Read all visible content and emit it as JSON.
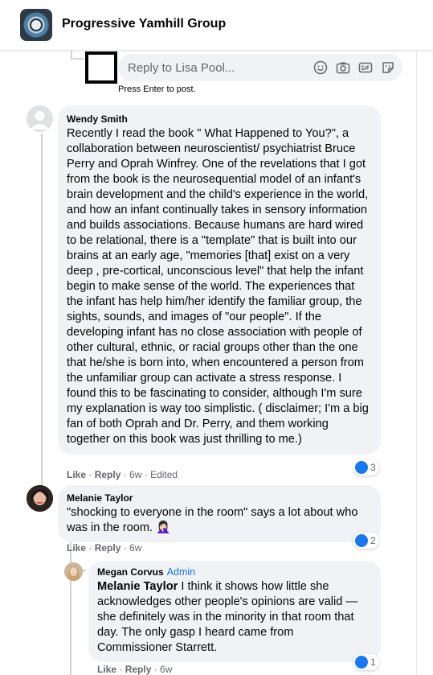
{
  "group": {
    "name": "Progressive Yamhill Group"
  },
  "reply_box": {
    "placeholder": "Reply to Lisa Pool...",
    "hint": "Press Enter to post."
  },
  "icons": [
    "group-photo-icon",
    "emoji-icon",
    "camera-icon",
    "gif-icon",
    "sticker-icon",
    "like-reaction-icon"
  ],
  "colors": {
    "bubble": "#f0f2f5",
    "accent": "#1877f2",
    "meta": "#65676b"
  },
  "comments": [
    {
      "author": "Wendy Smith",
      "text": "Recently I read the book \" What Happened to You?\", a collaboration between neuroscientist/ psychiatrist Bruce Perry and Oprah Winfrey. One of the revelations that I got from the book is the neurosequential model of an infant's brain development and the child's experience in the world, and how an infant continually takes in sensory information and builds associations. Because humans are hard wired to be relational, there is a \"template\" that is built into our brains at an early age, \"memories [that] exist on a very deep , pre-cortical, unconscious level\" that help the infant begin to make sense of the world. The experiences that the infant has help him/her identify the familiar group, the sights, sounds, and images of \"our people\". If the developing infant has no close association with people of other cultural, ethnic, or racial groups other than the one that he/she is born into, when encountered a person from the unfamiliar group can activate a stress response. I found this to be fascinating to consider, although I'm sure my explanation is way too simplistic. ( disclaimer; I'm a big fan of both Oprah and Dr. Perry, and them working together on this book was just thrilling to me.)",
      "like": "Like",
      "reply": "Reply",
      "time": "6w",
      "edited": "Edited",
      "reactions": "3"
    },
    {
      "author": "Melanie Taylor",
      "text": "\"shocking to everyone in the room\" says a lot about who was in the room. 🤦🏻‍♀️",
      "like": "Like",
      "reply": "Reply",
      "time": "6w",
      "reactions": "2"
    },
    {
      "author": "Megan Corvus",
      "badge": "Admin",
      "mention": "Melanie Taylor",
      "text": " I think it shows how little she acknowledges other people's opinions are valid — she definitely was in the minority in that room that day. The only gasp I heard came from Commissioner Starrett.",
      "like": "Like",
      "reply": "Reply",
      "time": "6w",
      "reactions": "1"
    }
  ]
}
